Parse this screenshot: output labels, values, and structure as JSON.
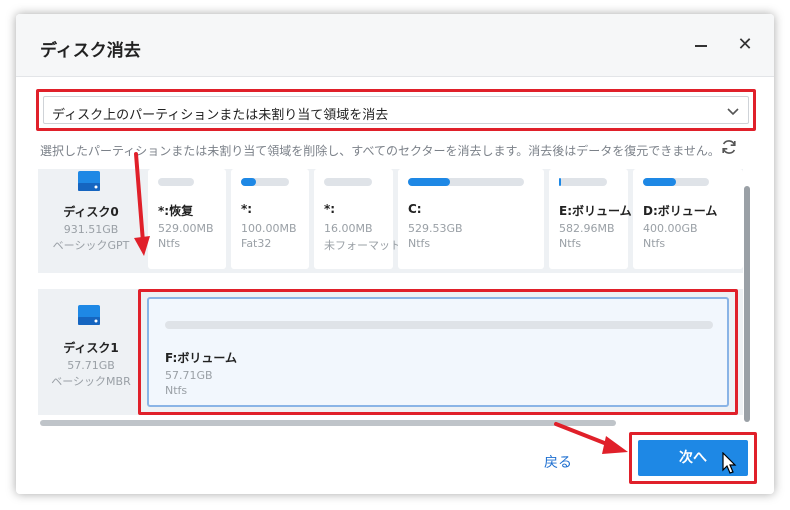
{
  "window": {
    "title": "ディスク消去"
  },
  "mode_select": {
    "value": "ディスク上のパーティションまたは未割り当て領域を消去"
  },
  "description": "選択したパーティションまたは未割り当て領域を削除し、すべてのセクターを消去します。消去後はデータを復元できません。",
  "disks": [
    {
      "name": "ディスク0",
      "size": "931.51GB",
      "type": "ベーシックGPT",
      "partitions": [
        {
          "name": "*:恢复",
          "size": "529.00MB",
          "fs": "Ntfs",
          "usage": 0.0
        },
        {
          "name": "*:",
          "size": "100.00MB",
          "fs": "Fat32",
          "usage": 0.32
        },
        {
          "name": "*:",
          "size": "16.00MB",
          "fs": "未フォーマット",
          "usage": 0.0
        },
        {
          "name": "C:",
          "size": "529.53GB",
          "fs": "Ntfs",
          "usage": 0.36
        },
        {
          "name": "E:ボリューム",
          "size": "582.96MB",
          "fs": "Ntfs",
          "usage": 0.05
        },
        {
          "name": "D:ボリューム",
          "size": "400.00GB",
          "fs": "Ntfs",
          "usage": 0.5
        }
      ]
    },
    {
      "name": "ディスク1",
      "size": "57.71GB",
      "type": "ベーシックMBR",
      "partitions": [
        {
          "name": "F:ボリューム",
          "size": "57.71GB",
          "fs": "Ntfs",
          "usage": 0.0
        }
      ]
    }
  ],
  "buttons": {
    "back": "戻る",
    "next": "次へ"
  },
  "colors": {
    "accent": "#1e88e5",
    "highlight": "#e0202a"
  }
}
